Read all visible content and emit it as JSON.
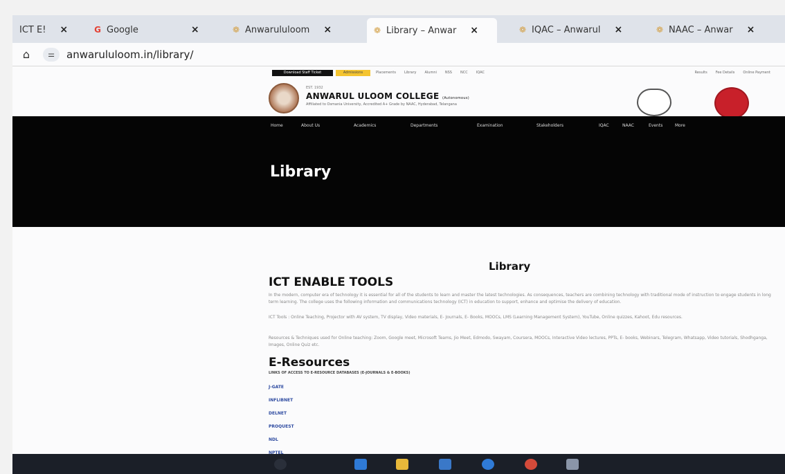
{
  "browser": {
    "tabs": [
      {
        "label": "ICT E!",
        "close": "×",
        "favicon": ""
      },
      {
        "label": "Google",
        "close": "×",
        "favicon": "G"
      },
      {
        "label": "Anwarululoom",
        "close": "×",
        "favicon": "site-logo-icon"
      },
      {
        "label": "Library – Anwar",
        "close": "×",
        "favicon": "site-logo-icon",
        "active": true
      },
      {
        "label": "IQAC – Anwarul",
        "close": "×",
        "favicon": "site-logo-icon"
      },
      {
        "label": "NAAC – Anwar",
        "close": "×",
        "favicon": "site-logo-icon"
      }
    ],
    "url": "anwarululoom.in/library/"
  },
  "site": {
    "topbar": {
      "download_label": "Download Staff Ticket",
      "highlight_label": "Admissions",
      "links": [
        "Placements",
        "Library",
        "Alumni",
        "NSS",
        "NCC",
        "IQAC"
      ],
      "right_links": [
        "Results",
        "Fee Details",
        "Online Payment"
      ]
    },
    "brand": {
      "est": "EST. 1932",
      "name": "ANWARUL ULOOM COLLEGE",
      "name_suffix": "(Autonomous)",
      "subtitle": "Affiliated to Osmania University, Accredited A+ Grade by NAAC, Hyderabad, Telangana"
    },
    "nav": [
      "Home",
      "About Us",
      "Academics",
      "Departments",
      "Examination",
      "Stakeholders",
      "IQAC",
      "NAAC",
      "Events",
      "More"
    ],
    "banner_title": "Library",
    "content": {
      "center_title": "Library",
      "ict_title": "ICT ENABLE TOOLS",
      "paragraphs": [
        "In the modern, computer era of technology it is essential for all of the students to learn and master the latest technologies. As consequences, teachers are combining technology with traditional mode of instruction to engage students in long term learning. The college uses the following information and communications technology (ICT) in education to support, enhance and optimise the delivery of education.",
        "ICT Tools : Online Teaching, Projector with AV system, TV display, Video materials, E- Journals, E- Books, MOOCs, LMS (Learning Management System), YouTube, Online quizzes, Kahoot, Edu resources.",
        "Resources & Techniques used for Online teaching: Zoom, Google meet, Microsoft Teams, Jio Meet, Edmodo, Swayam, Coursera, MOOCs, Interactive Video lectures, PPTs, E- books, Webinars, Telegram, Whatsapp, Video tutorials, Shodhganga, Images, Online Quiz etc."
      ],
      "eres_title": "E-Resources",
      "eres_sub": "LINKS OF ACCESS TO E-RESOURCE DATABASES (E-JOURNALS & E-BOOKS)",
      "resources": [
        "J-GATE",
        "INFLIBNET",
        "DELNET",
        "PROQUEST",
        "NDL",
        "NPTEL"
      ]
    }
  },
  "colors": {
    "tabstrip": "#dfe3ea",
    "navbar": "#050505",
    "accent_yellow": "#f4c430",
    "link_blue": "#2d4aa0"
  }
}
